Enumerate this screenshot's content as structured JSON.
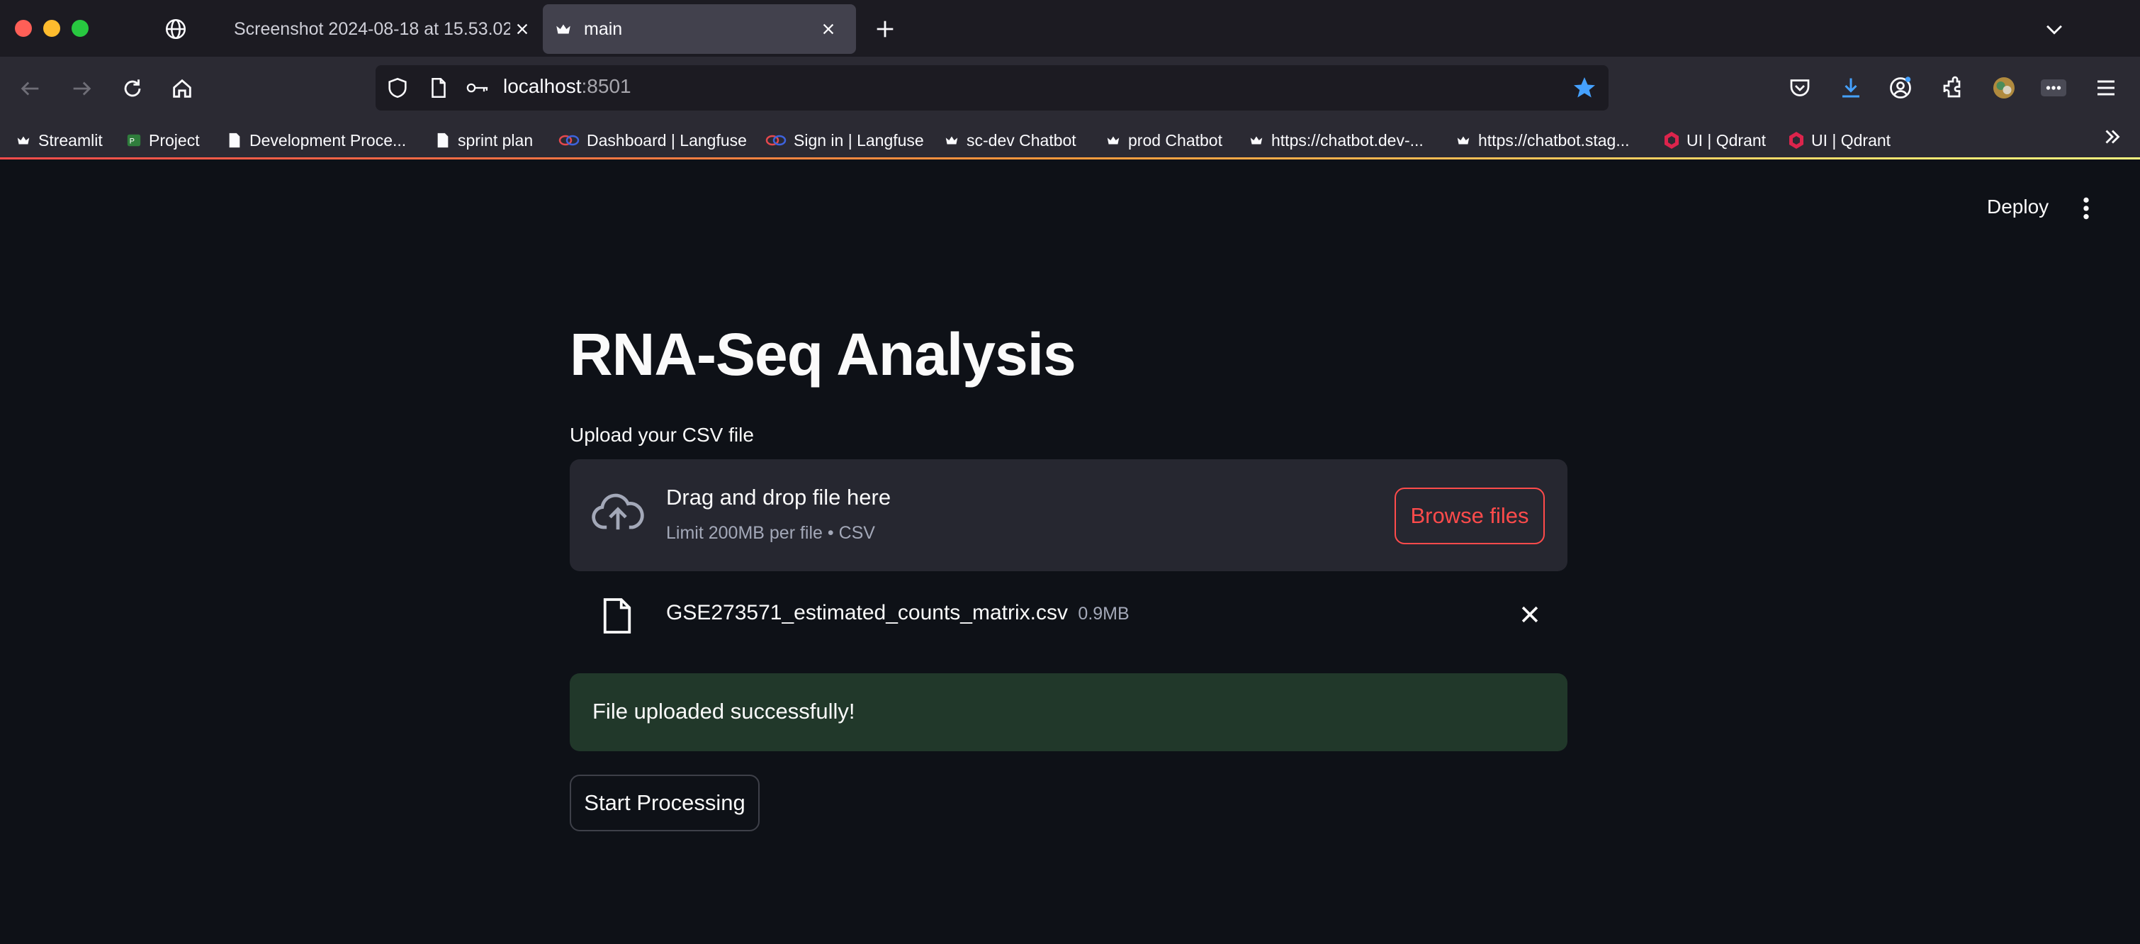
{
  "browser": {
    "tabs": [
      {
        "label": "Screenshot 2024-08-18 at 15.53.02",
        "active": false
      },
      {
        "label": "main",
        "active": true
      }
    ],
    "address": {
      "host": "localhost",
      "port": ":8501"
    },
    "bookmarks": [
      {
        "label": "Streamlit",
        "icon": "streamlit-crown-icon"
      },
      {
        "label": "Project",
        "icon": "project-icon"
      },
      {
        "label": "Development Proce...",
        "icon": "document-icon"
      },
      {
        "label": "sprint plan",
        "icon": "document-icon"
      },
      {
        "label": "Dashboard | Langfuse",
        "icon": "langfuse-icon"
      },
      {
        "label": "Sign in | Langfuse",
        "icon": "langfuse-icon"
      },
      {
        "label": "sc-dev Chatbot",
        "icon": "streamlit-crown-icon"
      },
      {
        "label": "prod Chatbot",
        "icon": "streamlit-crown-icon"
      },
      {
        "label": "https://chatbot.dev-...",
        "icon": "streamlit-crown-icon"
      },
      {
        "label": "https://chatbot.stag...",
        "icon": "streamlit-crown-icon"
      },
      {
        "label": "UI | Qdrant",
        "icon": "qdrant-icon"
      },
      {
        "label": "UI | Qdrant",
        "icon": "qdrant-icon"
      }
    ]
  },
  "header": {
    "deploy_label": "Deploy"
  },
  "main": {
    "title": "RNA-Seq Analysis",
    "uploader": {
      "label": "Upload your CSV file",
      "drop_text": "Drag and drop file here",
      "limit_text": "Limit 200MB per file • CSV",
      "browse_label": "Browse files"
    },
    "uploaded_file": {
      "name": "GSE273571_estimated_counts_matrix.csv",
      "size": "0.9MB"
    },
    "success_message": "File uploaded successfully!",
    "start_button": "Start Processing"
  },
  "colors": {
    "accent": "#ff4b4b",
    "background": "#0e1117",
    "success_bg": "#21382a",
    "dropzone_bg": "#262730",
    "bookmark_star": "#45a1ff"
  }
}
